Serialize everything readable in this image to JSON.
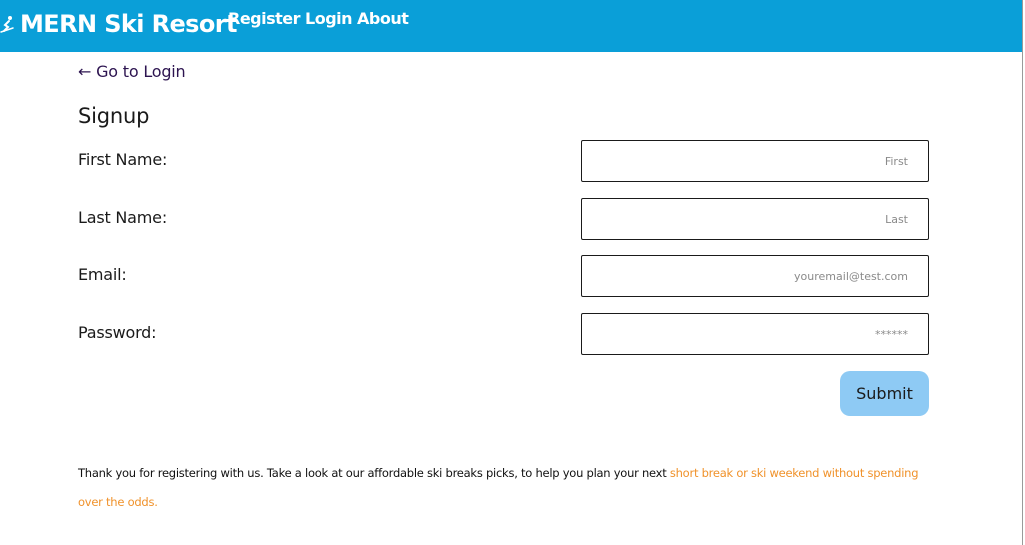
{
  "header": {
    "brand": "MERN Ski Resort",
    "brand_icon": "skier-icon",
    "nav": [
      "Register",
      "Login",
      "About"
    ],
    "background_color": "#0a9fd8"
  },
  "back_link": "← Go to Login",
  "form": {
    "title": "Signup",
    "fields": [
      {
        "label": "First Name:",
        "placeholder": "First"
      },
      {
        "label": "Last Name:",
        "placeholder": "Last"
      },
      {
        "label": "Email:",
        "placeholder": "youremail@test.com"
      },
      {
        "label": "Password:",
        "placeholder": "******"
      }
    ],
    "submit_label": "Submit",
    "submit_color": "#8ecaf4"
  },
  "footer": {
    "text": "Thank you for registering with us. Take a look at our affordable ski breaks picks, to help you plan your next ",
    "highlight": "short break or ski weekend without spending over the odds.",
    "highlight_color": "#f0922b"
  }
}
